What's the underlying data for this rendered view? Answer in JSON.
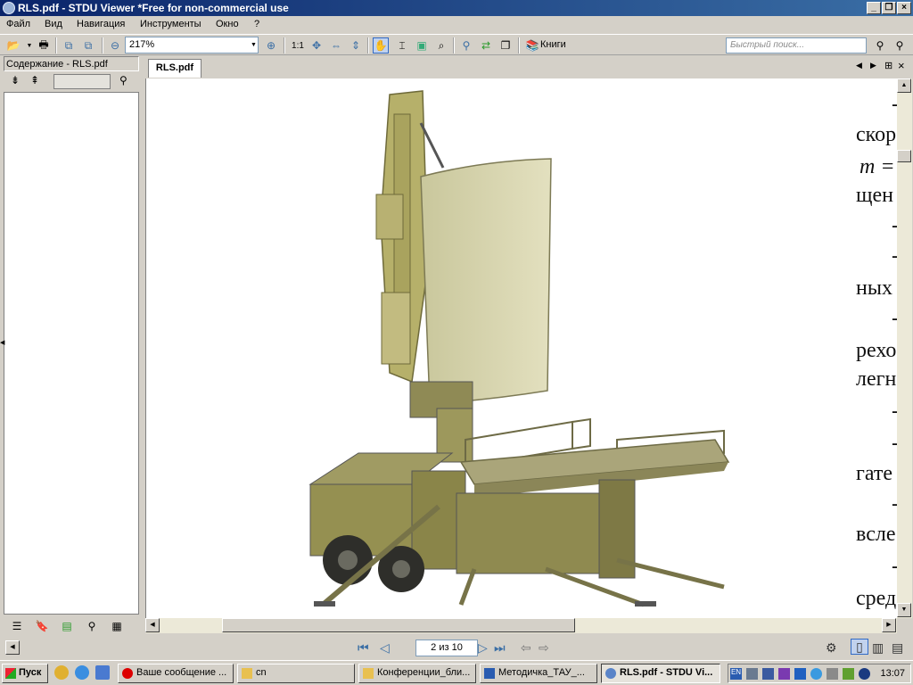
{
  "window": {
    "title": "RLS.pdf - STDU Viewer *Free for non-commercial use",
    "min_label": "_",
    "max_label": "❐",
    "close_label": "×"
  },
  "menu": [
    {
      "label": "Файл"
    },
    {
      "label": "Вид"
    },
    {
      "label": "Навигация"
    },
    {
      "label": "Инструменты"
    },
    {
      "label": "Окно"
    },
    {
      "label": "?"
    }
  ],
  "toolbar": {
    "zoom_value": "217%",
    "actual_size_label": "1:1",
    "books_label": "Книги",
    "search_placeholder": "Быстрый поиск..."
  },
  "left_panel": {
    "header": "Содержание - RLS.pdf"
  },
  "document": {
    "tab_label": "RLS.pdf",
    "page_text_lines": [
      "скор",
      "m =",
      "щен",
      "ных",
      "рехо",
      "легн",
      "гате",
      "всле",
      "сред"
    ],
    "tick_marks": [
      "-",
      "-",
      "-",
      "-",
      "-",
      "-",
      "-",
      "-"
    ]
  },
  "navigation": {
    "page_indicator": "2 из 10"
  },
  "taskbar": {
    "start_label": "Пуск",
    "tasks": [
      {
        "label": "Ваше сообщение ..."
      },
      {
        "label": "cn"
      },
      {
        "label": "Конференции_бли..."
      },
      {
        "label": "Методичка_ТАУ_..."
      },
      {
        "label": "RLS.pdf - STDU Vi..."
      }
    ],
    "lang": "EN",
    "clock": "13:07"
  }
}
